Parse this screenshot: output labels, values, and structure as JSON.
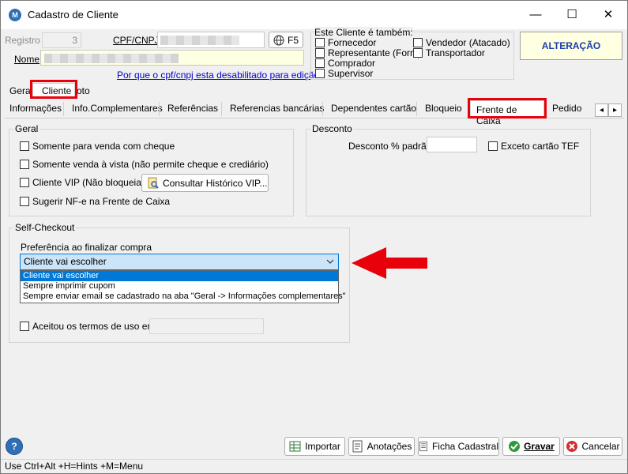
{
  "window": {
    "title": "Cadastro de Cliente",
    "controls": {
      "minimize": "—",
      "maximize": "☐",
      "close": "✕"
    }
  },
  "header": {
    "registro_label": "Registro",
    "registro_value": "3",
    "cpf_label": "CPF/CNPJ",
    "f5_label": "F5",
    "nome_label": "Nome",
    "cpf_disabled_link": "Por que o cpf/cnpj esta desabilitado para edição?",
    "status_badge": "ALTERAÇÃO"
  },
  "tambem": {
    "title": "Este Cliente é também:",
    "items": [
      {
        "label": "Fornecedor",
        "checked": false
      },
      {
        "label": "Representante (Forn.)",
        "checked": false
      },
      {
        "label": "Comprador",
        "checked": false
      },
      {
        "label": "Supervisor",
        "checked": false
      },
      {
        "label": "Vendedor (Atacado)",
        "checked": false
      },
      {
        "label": "Transportador",
        "checked": false
      }
    ]
  },
  "top_tabs": [
    {
      "label": "Geral"
    },
    {
      "label": "Cliente",
      "active": true
    },
    {
      "label": "oto"
    }
  ],
  "sub_tabs": [
    {
      "label": "Informações"
    },
    {
      "label": "Info.Complementares"
    },
    {
      "label": "Referências"
    },
    {
      "label": "Referencias bancárias"
    },
    {
      "label": "Dependentes cartão"
    },
    {
      "label": "Bloqueio"
    },
    {
      "label": "Frente de Caixa",
      "active": true
    },
    {
      "label": "Pedido"
    }
  ],
  "tab_scroll": {
    "left": "◂",
    "right": "▸"
  },
  "geral_group": {
    "title": "Geral",
    "options": [
      {
        "label": "Somente para venda com cheque",
        "checked": false
      },
      {
        "label": "Somente venda à vista (não permite cheque e crediário)",
        "checked": false
      },
      {
        "label": "Cliente VIP (Não bloqueia)",
        "checked": false
      },
      {
        "label": "Sugerir NF-e na Frente de Caixa",
        "checked": false
      }
    ],
    "vip_history_button": "Consultar Histórico VIP..."
  },
  "desconto_group": {
    "title": "Desconto",
    "percent_label": "Desconto % padrão",
    "percent_value": "",
    "tef_exception": {
      "label": "Exceto cartão TEF",
      "checked": false
    }
  },
  "self_checkout": {
    "title": "Self-Checkout",
    "pref_label": "Preferência ao finalizar compra",
    "selected": "Cliente vai escolher",
    "options": [
      "Cliente vai escolher",
      "Sempre imprimir cupom",
      "Sempre enviar email se cadastrado na aba \"Geral -> Informações complementares\""
    ],
    "terms": {
      "label": "Aceitou os termos de uso em",
      "checked": false,
      "value": ""
    }
  },
  "bottom_buttons": {
    "importar": "Importar",
    "anotacoes": "Anotações",
    "ficha": "Ficha Cadastral",
    "gravar": "Gravar",
    "cancelar": "Cancelar"
  },
  "help": {
    "icon": "?"
  },
  "statusbar": {
    "text": "Use Ctrl+Alt +H=Hints +M=Menu"
  },
  "colors": {
    "highlight": "#e8000b",
    "accent": "#0078d7",
    "link": "#0000cc",
    "badge_text": "#1a3ca8"
  }
}
